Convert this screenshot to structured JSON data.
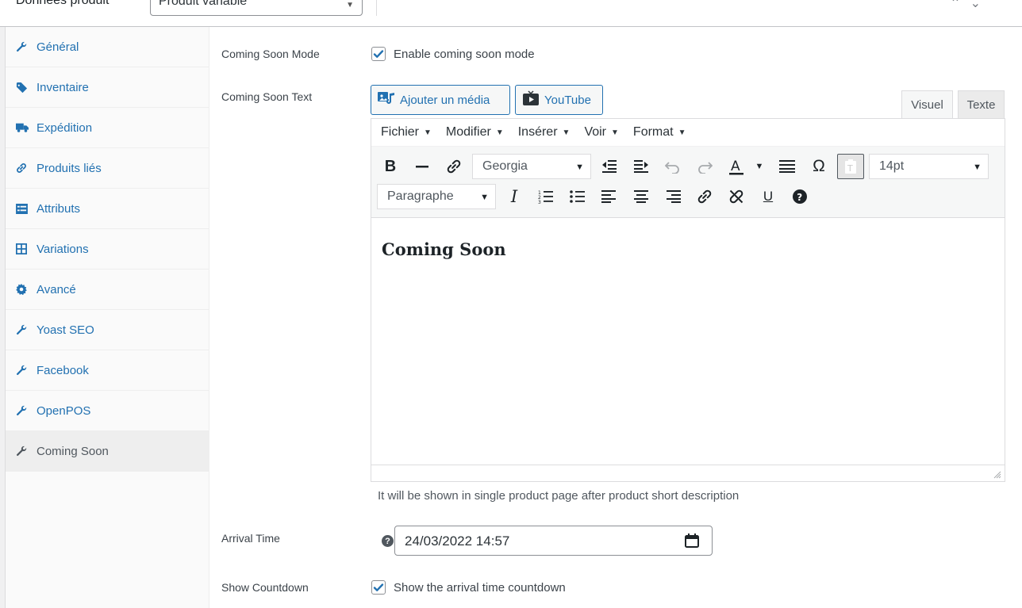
{
  "header": {
    "title": "Données produit",
    "product_type": "Produit variable"
  },
  "sidebar": {
    "items": [
      {
        "label": "Général",
        "icon": "wrench-icon"
      },
      {
        "label": "Inventaire",
        "icon": "tag-icon"
      },
      {
        "label": "Expédition",
        "icon": "truck-icon"
      },
      {
        "label": "Produits liés",
        "icon": "link-icon"
      },
      {
        "label": "Attributs",
        "icon": "list-icon"
      },
      {
        "label": "Variations",
        "icon": "grid-icon"
      },
      {
        "label": "Avancé",
        "icon": "gear-icon"
      },
      {
        "label": "Yoast SEO",
        "icon": "wrench-icon"
      },
      {
        "label": "Facebook",
        "icon": "wrench-icon"
      },
      {
        "label": "OpenPOS",
        "icon": "wrench-icon"
      },
      {
        "label": "Coming Soon",
        "icon": "wrench-icon"
      }
    ],
    "active": "Coming Soon"
  },
  "form": {
    "coming_soon_mode": {
      "label": "Coming Soon Mode",
      "checkbox_label": "Enable coming soon mode",
      "checked": true
    },
    "coming_soon_text": {
      "label": "Coming Soon Text"
    },
    "arrival_time": {
      "label": "Arrival Time",
      "value": "24/03/2022 14:57"
    },
    "show_countdown": {
      "label": "Show Countdown",
      "checkbox_label": "Show the arrival time countdown",
      "checked": true
    }
  },
  "editor": {
    "add_media_label": "Ajouter un média",
    "youtube_label": "YouTube",
    "tab_visual": "Visuel",
    "tab_text": "Texte",
    "menu": [
      "Fichier",
      "Modifier",
      "Insérer",
      "Voir",
      "Format"
    ],
    "font_family": "Georgia",
    "font_size": "14pt",
    "block_format": "Paragraphe",
    "content_heading": "Coming Soon",
    "help_text": "It will be shown in single product page after product short description"
  },
  "colors": {
    "accent": "#2271b1",
    "text": "#3c434a"
  }
}
